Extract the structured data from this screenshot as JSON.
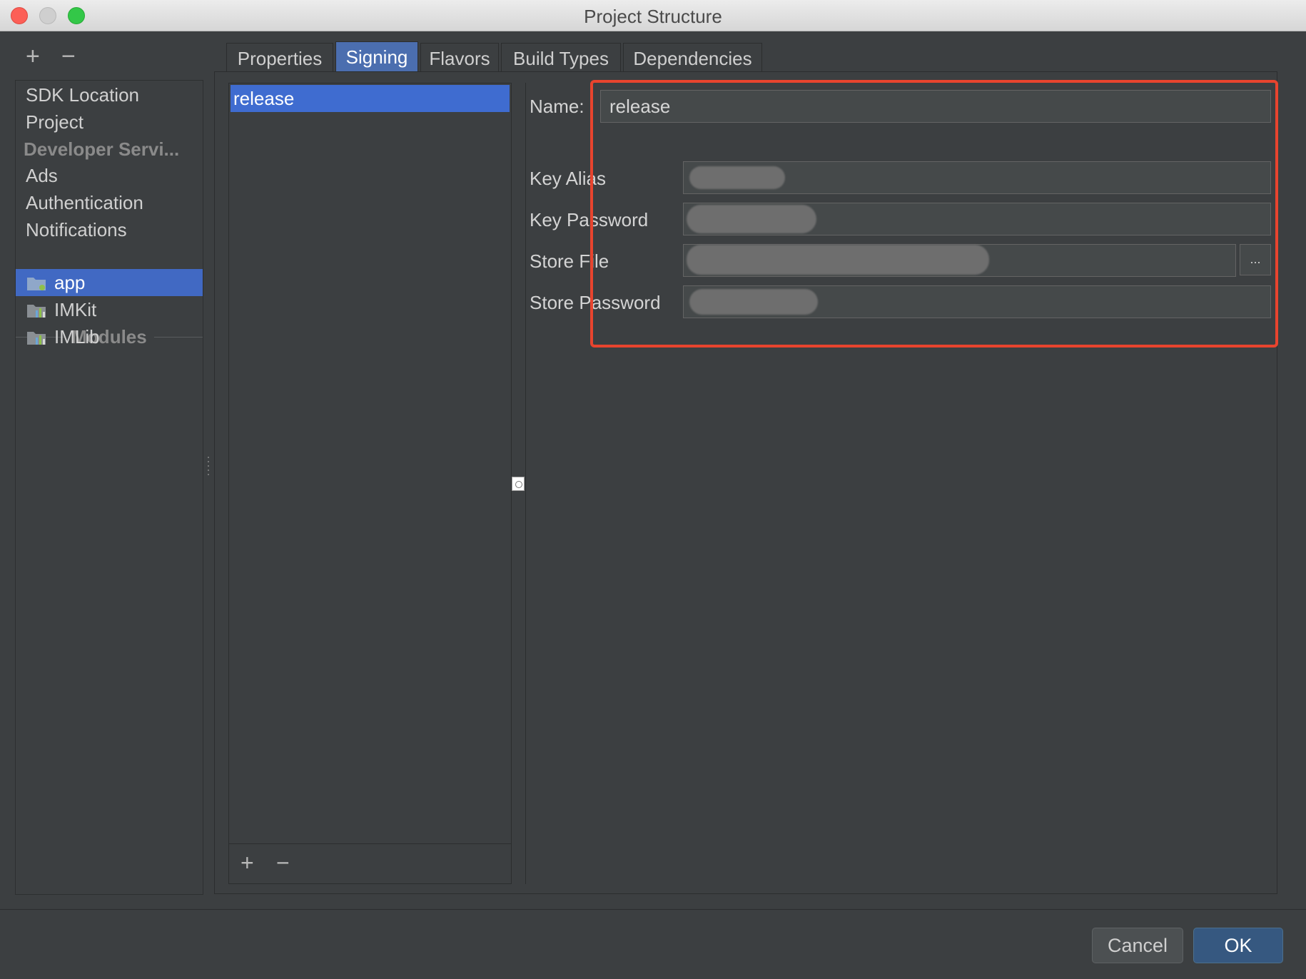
{
  "window": {
    "title": "Project Structure"
  },
  "left_toolbar": {
    "add": "+",
    "remove": "−"
  },
  "nav": {
    "items": [
      {
        "label": "SDK Location"
      },
      {
        "label": "Project"
      }
    ],
    "developer_header": "Developer Servi...",
    "dev_items": [
      {
        "label": "Ads"
      },
      {
        "label": "Authentication"
      },
      {
        "label": "Notifications"
      }
    ],
    "modules_header": "Modules",
    "modules": [
      {
        "label": "app",
        "selected": true
      },
      {
        "label": "IMKit",
        "selected": false
      },
      {
        "label": "IMLib",
        "selected": false
      }
    ]
  },
  "tabs": [
    {
      "label": "Properties",
      "active": false
    },
    {
      "label": "Signing",
      "active": true
    },
    {
      "label": "Flavors",
      "active": false
    },
    {
      "label": "Build Types",
      "active": false
    },
    {
      "label": "Dependencies",
      "active": false
    }
  ],
  "signing_list": {
    "items": [
      {
        "label": "release",
        "selected": true
      }
    ],
    "add": "+",
    "remove": "−"
  },
  "form": {
    "name_label": "Name:",
    "name_value": "release",
    "key_alias_label": "Key Alias",
    "key_password_label": "Key Password",
    "store_file_label": "Store File",
    "store_password_label": "Store Password",
    "browse_label": "..."
  },
  "buttons": {
    "cancel": "Cancel",
    "ok": "OK"
  },
  "colors": {
    "accent": "#4169c3",
    "highlight": "#e8442e",
    "background": "#3c3f41"
  }
}
